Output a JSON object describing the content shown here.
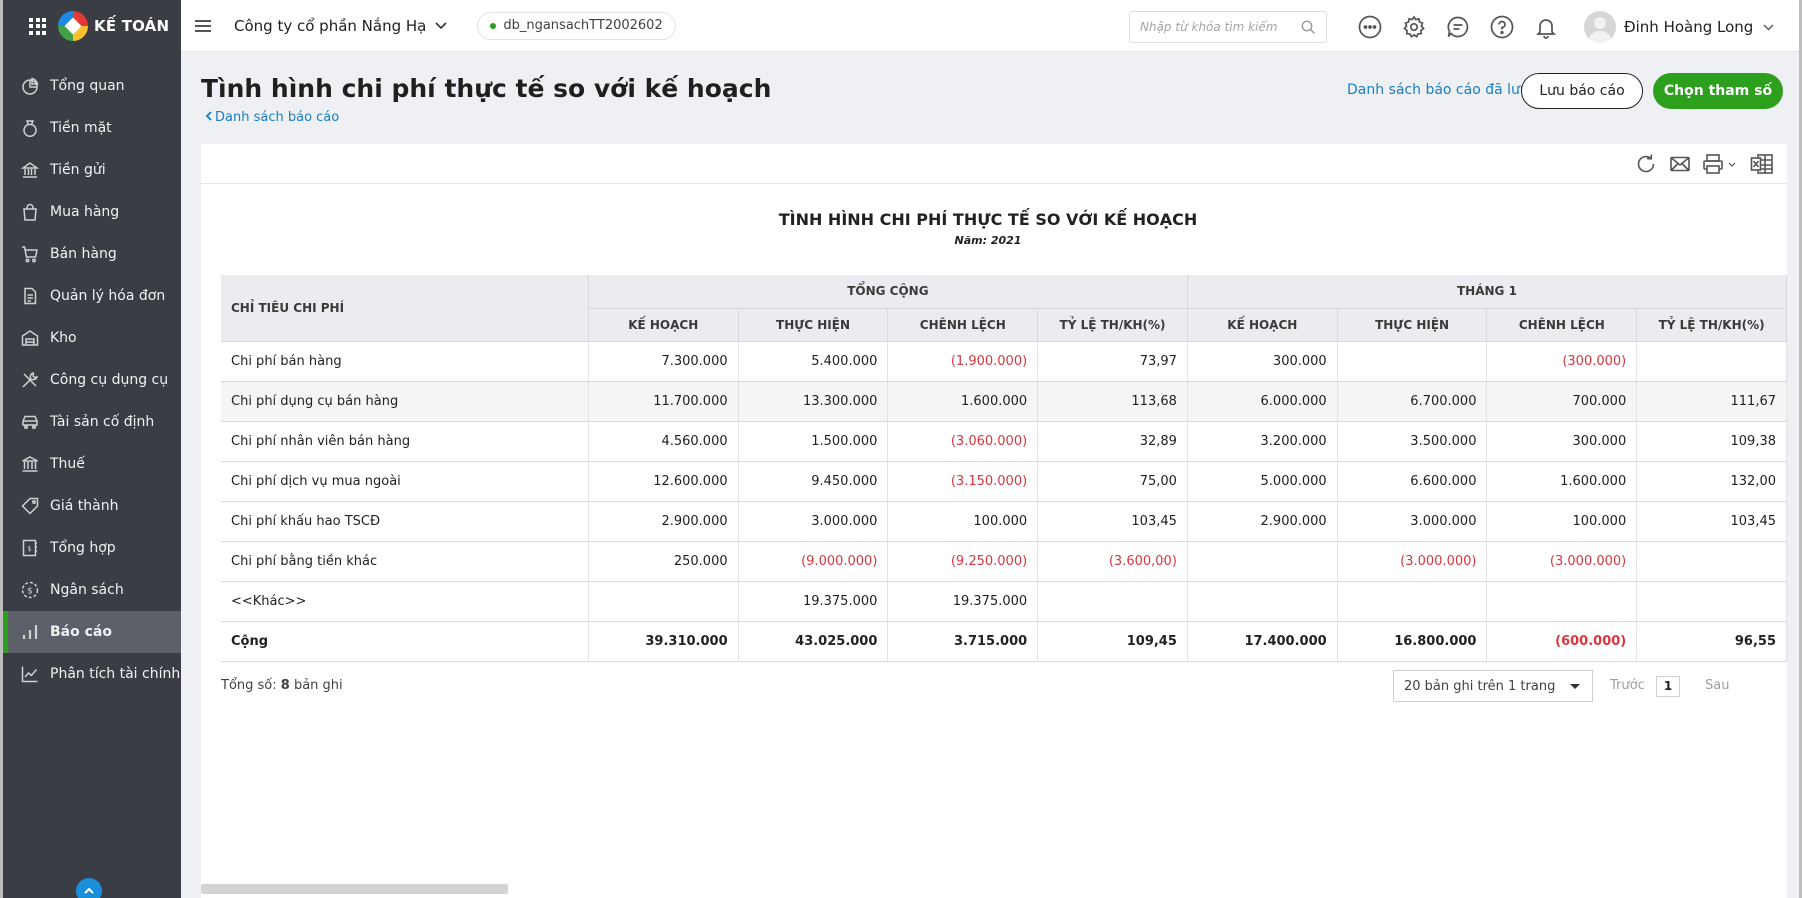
{
  "app": {
    "brand": "KẾ TOÁN"
  },
  "header": {
    "company": "Công ty cổ phần Nắng Hạ",
    "database": "db_ngansachTT2002602",
    "search_placeholder": "Nhập từ khóa tìm kiếm",
    "user_name": "Đinh Hoàng Long"
  },
  "sidebar": {
    "items": [
      {
        "label": "Tổng quan",
        "icon": "pie-chart-icon"
      },
      {
        "label": "Tiền mặt",
        "icon": "money-bag-icon"
      },
      {
        "label": "Tiền gửi",
        "icon": "bank-icon"
      },
      {
        "label": "Mua hàng",
        "icon": "shopping-bag-icon"
      },
      {
        "label": "Bán hàng",
        "icon": "cart-icon"
      },
      {
        "label": "Quản lý hóa đơn",
        "icon": "invoice-icon"
      },
      {
        "label": "Kho",
        "icon": "warehouse-icon"
      },
      {
        "label": "Công cụ dụng cụ",
        "icon": "tools-icon"
      },
      {
        "label": "Tài sản cố định",
        "icon": "car-icon"
      },
      {
        "label": "Thuế",
        "icon": "tax-building-icon"
      },
      {
        "label": "Giá thành",
        "icon": "price-tag-icon"
      },
      {
        "label": "Tổng hợp",
        "icon": "ledger-icon"
      },
      {
        "label": "Ngân sách",
        "icon": "budget-coin-icon"
      },
      {
        "label": "Báo cáo",
        "icon": "bar-chart-icon",
        "active": true
      },
      {
        "label": "Phân tích tài chính",
        "icon": "line-chart-icon"
      }
    ]
  },
  "page": {
    "title": "Tình hình chi phí thực tế so với kế hoạch",
    "back_link": "Danh sách báo cáo",
    "saved_reports_link": "Danh sách báo cáo đã lưu",
    "save_button": "Lưu báo cáo",
    "params_button": "Chọn tham số"
  },
  "report": {
    "title": "TÌNH HÌNH CHI PHÍ THỰC TẾ SO VỚI KẾ HOẠCH",
    "year_label": "Năm: 2021",
    "col_name_header": "CHỈ TIÊU CHI PHÍ",
    "groups": [
      "TỔNG CỘNG",
      "THÁNG 1"
    ],
    "sub_headers": [
      "KẾ HOẠCH",
      "THỰC HIỆN",
      "CHÊNH LỆCH",
      "TỶ LỆ TH/KH(%)"
    ],
    "rows": [
      {
        "name": "Chi phí bán hàng",
        "values": [
          "7.300.000",
          "5.400.000",
          "(1.900.000)",
          "73,97",
          "300.000",
          "",
          "(300.000)",
          ""
        ]
      },
      {
        "name": "Chi phí dụng cụ bán hàng",
        "values": [
          "11.700.000",
          "13.300.000",
          "1.600.000",
          "113,68",
          "6.000.000",
          "6.700.000",
          "700.000",
          "111,67"
        ]
      },
      {
        "name": "Chi phí nhân viên bán hàng",
        "values": [
          "4.560.000",
          "1.500.000",
          "(3.060.000)",
          "32,89",
          "3.200.000",
          "3.500.000",
          "300.000",
          "109,38"
        ]
      },
      {
        "name": "Chi phí dịch vụ mua ngoài",
        "values": [
          "12.600.000",
          "9.450.000",
          "(3.150.000)",
          "75,00",
          "5.000.000",
          "6.600.000",
          "1.600.000",
          "132,00"
        ]
      },
      {
        "name": "Chi phí khấu hao TSCĐ",
        "values": [
          "2.900.000",
          "3.000.000",
          "100.000",
          "103,45",
          "2.900.000",
          "3.000.000",
          "100.000",
          "103,45"
        ]
      },
      {
        "name": "Chi phí bằng tiền khác",
        "values": [
          "250.000",
          "(9.000.000)",
          "(9.250.000)",
          "(3.600,00)",
          "",
          "(3.000.000)",
          "(3.000.000)",
          ""
        ]
      },
      {
        "name": "<<Khác>>",
        "values": [
          "",
          "19.375.000",
          "19.375.000",
          "",
          "",
          "",
          "",
          ""
        ]
      },
      {
        "name": "Cộng",
        "total": true,
        "values": [
          "39.310.000",
          "43.025.000",
          "3.715.000",
          "109,45",
          "17.400.000",
          "16.800.000",
          "(600.000)",
          "96,55"
        ]
      }
    ]
  },
  "footer": {
    "total_prefix": "Tổng số: ",
    "total_count": "8",
    "total_suffix": " bản ghi",
    "page_size": "20 bản ghi trên 1 trang",
    "prev_label": "Trước",
    "current_page": "1",
    "next_label": "Sau"
  },
  "colors": {
    "accent": "#2ca01c",
    "link": "#1a7ec2",
    "negative": "#d9363e",
    "sidebar_bg": "#3b3d44"
  }
}
